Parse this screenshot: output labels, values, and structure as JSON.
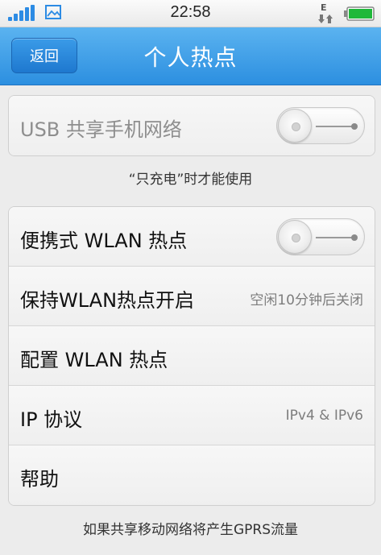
{
  "status_bar": {
    "time": "22:58",
    "icons": [
      "signal-icon",
      "image-icon",
      "network-e-icon",
      "battery-icon"
    ],
    "accent": "#2c8be4",
    "battery_color": "#1fb83a"
  },
  "header": {
    "back_label": "返回",
    "title": "个人热点",
    "color": "#3a9be8"
  },
  "usb_group": {
    "usb_label": "USB 共享手机网络",
    "usb_enabled": false,
    "usb_toggle_on": false,
    "note": "“只充电”时才能使用"
  },
  "wlan_group": {
    "items": [
      {
        "label": "便携式 WLAN 热点",
        "value": "",
        "toggle_on": false
      },
      {
        "label": "保持WLAN热点开启",
        "value": "空闲10分钟后关闭"
      },
      {
        "label": "配置 WLAN 热点",
        "value": ""
      },
      {
        "label": "IP 协议",
        "value": "IPv4 & IPv6"
      },
      {
        "label": "帮助",
        "value": ""
      }
    ]
  },
  "footer_note": "如果共享移动网络将产生GPRS流量"
}
